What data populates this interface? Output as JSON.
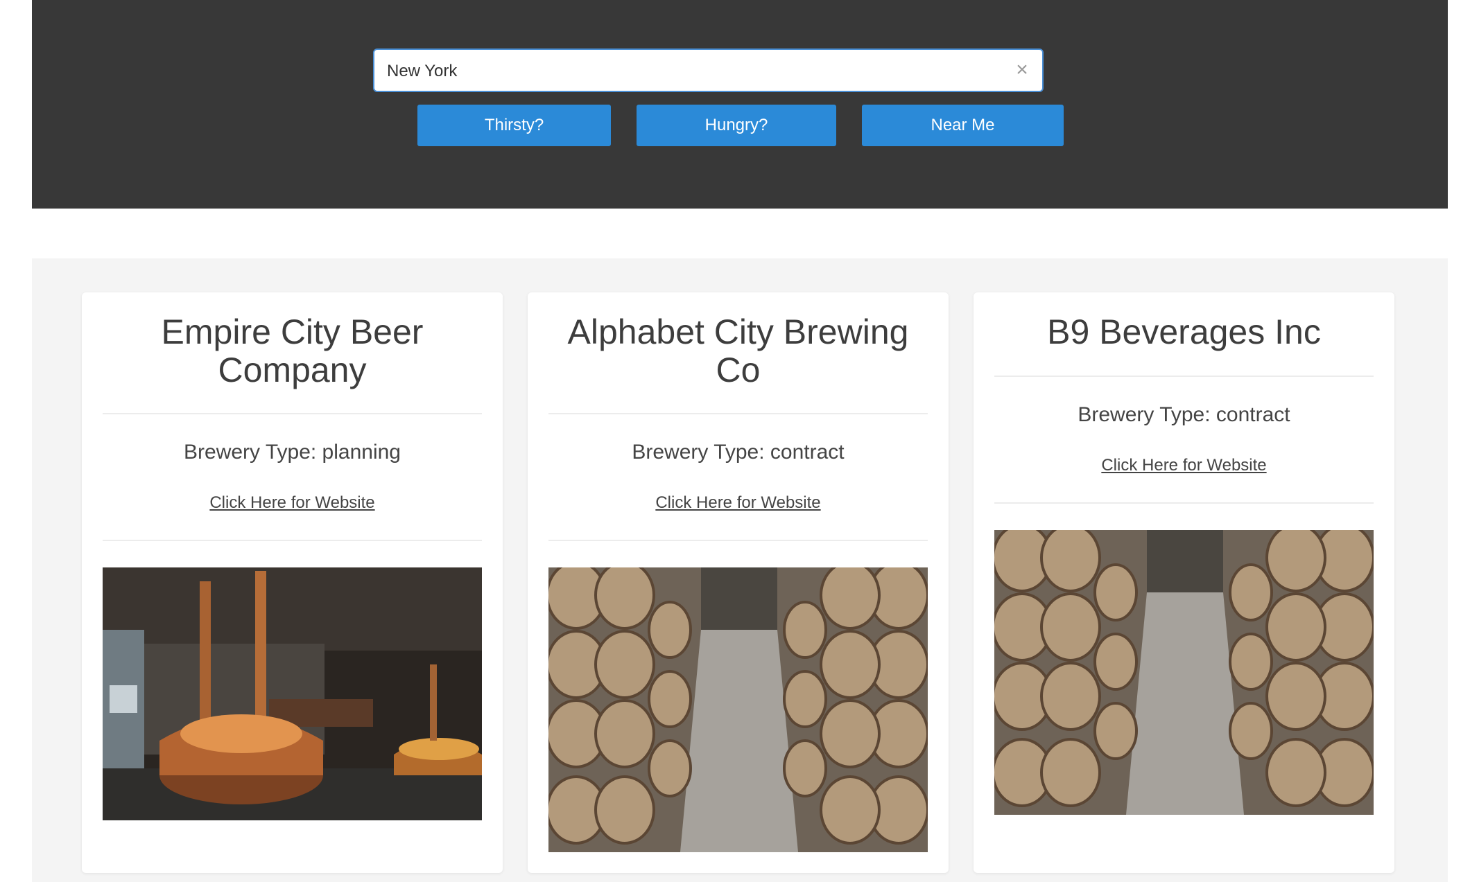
{
  "search": {
    "value": "New York",
    "clear_icon": "close-icon"
  },
  "buttons": {
    "thirsty": "Thirsty?",
    "hungry": "Hungry?",
    "near_me": "Near Me"
  },
  "colors": {
    "header_bg": "#383838",
    "accent": "#2b8ad8",
    "results_bg": "#f4f4f4"
  },
  "cards": [
    {
      "name_line1": "Empire City Beer",
      "name_line2": "Company",
      "type": "Brewery Type: planning",
      "link": "Click Here for Website",
      "image": "copper-brew-kettle-photo"
    },
    {
      "name_line1": "Alphabet City Brewing",
      "name_line2": "Co",
      "type": "Brewery Type: contract",
      "link": "Click Here for Website",
      "image": "barrel-warehouse-photo"
    },
    {
      "name_line1": "B9 Beverages Inc",
      "name_line2": "",
      "type": "Brewery Type: contract",
      "link": "Click Here for Website",
      "image": "barrel-warehouse-photo"
    }
  ]
}
